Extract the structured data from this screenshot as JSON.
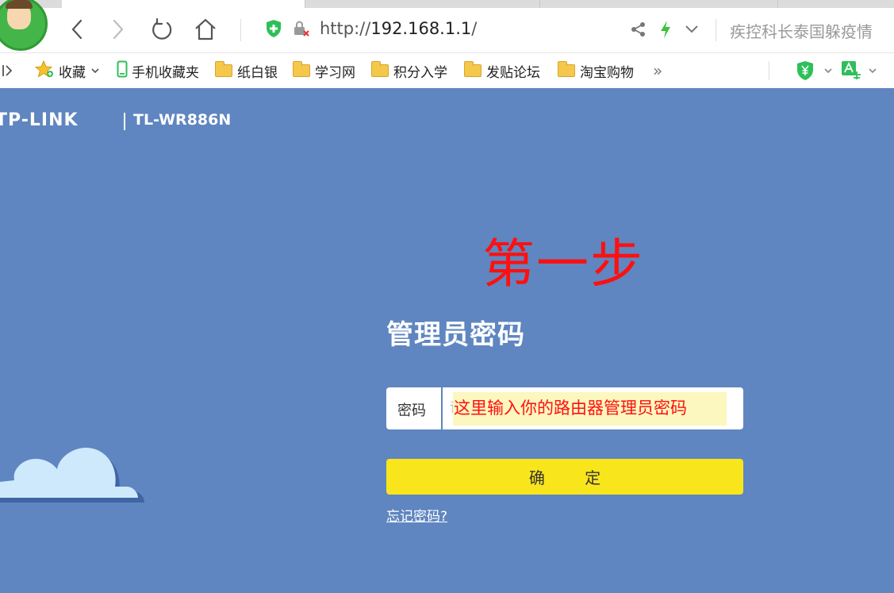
{
  "browser": {
    "url": {
      "scheme": "http://",
      "host": "192.168.1.1",
      "path": "/"
    },
    "search_hint": "疾控科长泰国躲疫情",
    "bookmarks": [
      {
        "label": "收藏",
        "icon": "star-icon"
      },
      {
        "label": "手机收藏夹",
        "icon": "phone-icon"
      },
      {
        "label": "纸白银",
        "icon": "folder-icon"
      },
      {
        "label": "学习网",
        "icon": "folder-icon"
      },
      {
        "label": "积分入学",
        "icon": "folder-icon"
      },
      {
        "label": "发贴论坛",
        "icon": "folder-icon"
      },
      {
        "label": "淘宝购物",
        "icon": "folder-icon"
      }
    ],
    "more_glyph": "»",
    "colors": {
      "secure_green": "#2fbf5a",
      "lightning_green": "#3ac43a"
    }
  },
  "router": {
    "brand": "TP-LINK",
    "model": "TL-WR886N",
    "title": "管理员密码",
    "password_label": "密码",
    "password_placeholder": "请输入管理员密码",
    "confirm_label": "确 定",
    "forgot_link": "忘记密码?",
    "colors": {
      "background": "#5f86c0",
      "button": "#f9e51b"
    }
  },
  "annotations": {
    "step": "第一步",
    "input_hint": "这里输入你的路由器管理员密码",
    "color": "#ff1010"
  }
}
